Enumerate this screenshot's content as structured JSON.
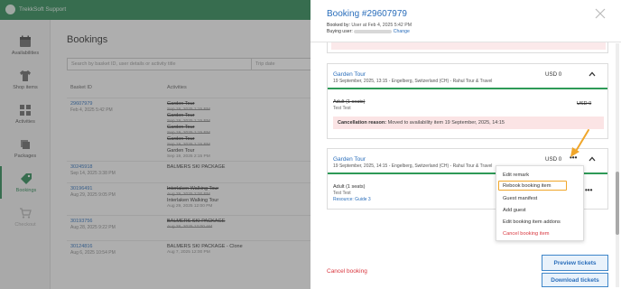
{
  "app": {
    "brand": "TrekkSoft Support"
  },
  "sidebar": {
    "items": [
      {
        "label": "Availabilities",
        "icon": "calendar-icon"
      },
      {
        "label": "Shop items",
        "icon": "shirt-icon"
      },
      {
        "label": "Activities",
        "icon": "grid-icon"
      },
      {
        "label": "Packages",
        "icon": "layers-icon"
      },
      {
        "label": "Bookings",
        "icon": "tag-icon",
        "active": true
      },
      {
        "label": "Checkout",
        "icon": "cart-icon"
      }
    ]
  },
  "bookings_page": {
    "title": "Bookings",
    "search_placeholder": "Search by basket ID, user details or activity title",
    "date_placeholder": "Trip date",
    "columns": [
      "Basket ID",
      "Activities"
    ],
    "rows": [
      {
        "id": "29607979",
        "date": "Feb 4, 2025 5:42 PM",
        "activities": [
          {
            "name": "Garden Tour",
            "strike": true
          },
          {
            "date": "Sep 19, 2025 1:15 PM",
            "strike": true
          },
          {
            "name": "Garden Tour",
            "strike": true
          },
          {
            "date": "Sep 19, 2025 1:15 PM",
            "strike": true
          },
          {
            "name": "Garden Tour",
            "strike": true
          },
          {
            "date": "Sep 19, 2025 1:15 PM",
            "strike": true
          },
          {
            "name": "Garden Tour",
            "strike": true
          },
          {
            "date": "Sep 19, 2025 1:15 PM",
            "strike": true
          },
          {
            "name": "Garden Tour",
            "strike": false
          },
          {
            "date": "Sep 19, 2025 2:15 PM",
            "strike": false
          }
        ]
      },
      {
        "id": "30245918",
        "date": "Sep 14, 2025 3:38 PM",
        "activities": [
          {
            "name": "BALMERS SKI PACKAGE",
            "strike": false
          }
        ]
      },
      {
        "id": "30196491",
        "date": "Aug 29, 2025 9:05 PM",
        "activities": [
          {
            "name": "Interlaken Walking Tour",
            "strike": true
          },
          {
            "date": "Aug 29, 2025 2:00 PM",
            "strike": true
          },
          {
            "name": "Interlaken Walking Tour",
            "strike": false
          },
          {
            "date": "Aug 29, 2025 12:00 PM",
            "strike": false
          }
        ]
      },
      {
        "id": "30193756",
        "date": "Aug 28, 2025 9:22 PM",
        "activities": [
          {
            "name": "BALMERS SKI PACKAGE",
            "strike": true
          },
          {
            "date": "Aug 28, 2025 12:00 AM",
            "strike": true
          }
        ]
      },
      {
        "id": "30124816",
        "date": "Aug 6, 2025 10:54 PM",
        "activities": [
          {
            "name": "BALMERS SKI PACKAGE - Clone",
            "strike": false
          },
          {
            "date": "Aug 7, 2025 12:00 PM",
            "strike": false
          }
        ]
      }
    ]
  },
  "drawer": {
    "title": "Booking #29607979",
    "booked_by_label": "Booked by:",
    "booked_by_value": "User at Feb 4, 2025 5:42 PM",
    "buying_user_label": "Buying user:",
    "change_link": "Change",
    "cards": [
      {
        "title": "Garden Tour",
        "subtitle": "19 September, 2025, 13:15 - Engelberg, Switzerland (CH) - Rahul Tour & Travel",
        "price": "USD 0",
        "item": {
          "name": "Adult (1 seats)",
          "guest": "Test Test",
          "price": "USD 0",
          "strike": true
        },
        "cancellation_label": "Cancellation reason:",
        "cancellation_text": "Moved to availability item 19 September, 2025, 14:15"
      },
      {
        "title": "Garden Tour",
        "subtitle": "19 September, 2025, 14:15 - Engelberg, Switzerland (CH) - Rahul Tour & Travel",
        "price": "USD 0",
        "item": {
          "name": "Adult (1 seats)",
          "guest": "Test Test",
          "resource": "Resource: Guide 3"
        }
      }
    ],
    "more_symbol": "•••",
    "context_menu": [
      {
        "label": "Edit remark"
      },
      {
        "label": "Rebook booking item",
        "highlighted": true
      },
      {
        "label": "Guest manifest"
      },
      {
        "label": "Add guest"
      },
      {
        "label": "Edit booking item addons"
      },
      {
        "label": "Cancel booking item",
        "danger": true
      }
    ],
    "cancel_booking": "Cancel booking",
    "preview_tickets": "Preview tickets",
    "download_tickets": "Download tickets"
  },
  "colors": {
    "brand_green": "#2e8b57",
    "link_blue": "#2a6ebb",
    "danger_red": "#d9363e",
    "highlight_orange": "#f0a62a"
  }
}
